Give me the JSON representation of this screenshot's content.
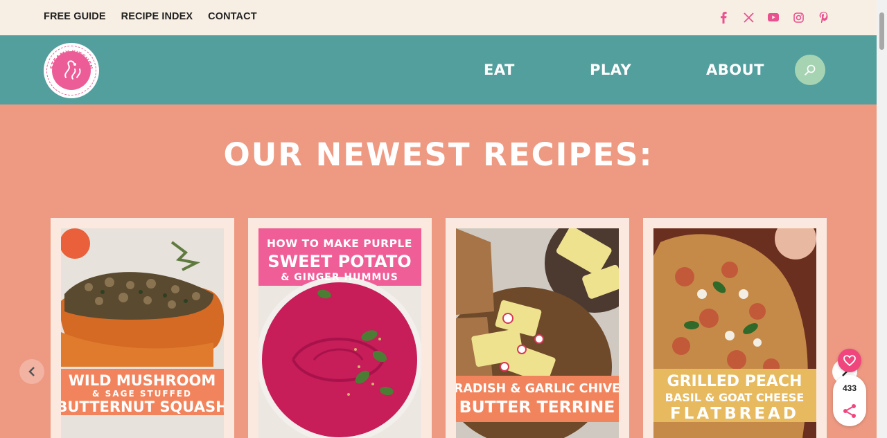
{
  "top_links": [
    "FREE GUIDE",
    "RECIPE INDEX",
    "CONTACT"
  ],
  "social_icons": [
    "facebook-icon",
    "x-icon",
    "youtube-icon",
    "instagram-icon",
    "pinterest-icon"
  ],
  "logo": {
    "text_top": "STEAMY KITCHEN",
    "text_bottom": "SIMPLE PLEASURES"
  },
  "nav": {
    "eat": "EAT",
    "play": "PLAY",
    "about": "ABOUT"
  },
  "headline": "OUR NEWEST RECIPES:",
  "cards": [
    {
      "line1": "WILD MUSHROOM",
      "line2": "& SAGE STUFFED",
      "line3": "BUTTERNUT SQUASH"
    },
    {
      "line1": "HOW TO MAKE PURPLE",
      "line2": "SWEET POTATO",
      "line3": "& GINGER HUMMUS"
    },
    {
      "line1": "RADISH & GARLIC CHIVE",
      "line2": "BUTTER TERRINE"
    },
    {
      "line1": "GRILLED PEACH",
      "line2": "BASIL & GOAT CHEESE",
      "line3": "FLATBREAD"
    }
  ],
  "share_count": "433",
  "colors": {
    "topbar": "#f8efe4",
    "nav": "#529f9d",
    "body": "#ee9a83",
    "accent_pink": "#ec5d97"
  }
}
